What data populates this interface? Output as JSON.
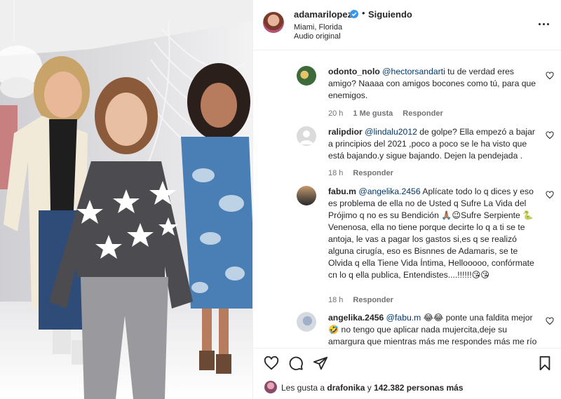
{
  "header": {
    "username": "adamarilopez",
    "dot": "•",
    "follow_status": "Siguiendo",
    "location": "Miami, Florida",
    "audio": "Audio original"
  },
  "comments": [
    {
      "user": "odonto_nolo",
      "mention": "@hectorsandarti",
      "text": " tu de verdad eres amigo? Naaaa con amigos bocones como tú, para que enemigos.",
      "time": "20 h",
      "likes": "1 Me gusta",
      "reply": "Responder"
    },
    {
      "user": "ralipdior",
      "mention": "@lindalu2012",
      "text": " de golpe? Ella empezó a bajar a principios del 2021 ,poco a poco se le ha visto que está bajando.y sigue bajando. Dejen la pendejada .",
      "time": "18 h",
      "likes": "",
      "reply": "Responder"
    },
    {
      "user": "fabu.m",
      "mention": "@angelika.2456",
      "text": " Aplícate todo lo q dices y eso es problema de ella no de Usted q Sufre La Vida del Prójimo q no es su Bendición 🙏🏽😉Sufre Serpiente 🐍 Venenosa, ella no tiene porque decirte lo q a ti se te antoja, le vas a pagar los gastos si,es q se realizó alguna cirugía, eso es Bisnnes de Adamaris, se te Olvida q ella Tiene Vida Íntima, Hellooooo, confórmate cn lo q ella publica, Entendistes....!!!!!!😘😘",
      "time": "18 h",
      "likes": "",
      "reply": "Responder"
    },
    {
      "user": "angelika.2456",
      "mention": "@fabu.m",
      "text": " 😂😂 ponte una faldita mejor 🤣 no tengo que aplicar nada mujercita,deje su amargura que mientras más me respondes más me río",
      "time": "",
      "likes": "",
      "reply": ""
    }
  ],
  "likes_bar": {
    "prefix": "Les gusta a ",
    "user": "drafonika",
    "middle": " y ",
    "count": "142.382 personas más"
  },
  "icons": {
    "verified": "verified-badge-icon",
    "more": "more-options-icon",
    "heart": "heart-icon",
    "comment": "comment-icon",
    "share": "share-icon",
    "save": "bookmark-icon"
  },
  "colors": {
    "verified": "#3897f0",
    "mention": "#00376b",
    "meta": "#737373"
  }
}
